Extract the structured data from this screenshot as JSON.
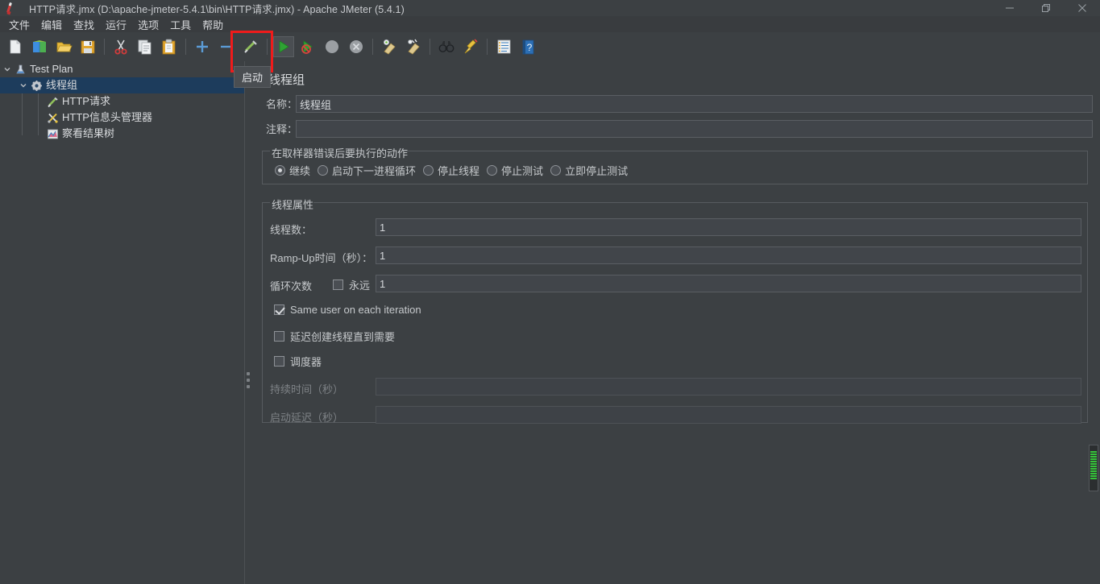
{
  "window": {
    "title": "HTTP请求.jmx (D:\\apache-jmeter-5.4.1\\bin\\HTTP请求.jmx) - Apache JMeter (5.4.1)",
    "app_icon": "jmeter-feather-icon",
    "controls": {
      "minimize": "minimize-icon",
      "maximize": "maximize-icon",
      "close": "close-icon"
    }
  },
  "menubar": {
    "items": [
      {
        "label": "文件"
      },
      {
        "label": "编辑"
      },
      {
        "label": "查找"
      },
      {
        "label": "运行"
      },
      {
        "label": "选项"
      },
      {
        "label": "工具"
      },
      {
        "label": "帮助"
      }
    ]
  },
  "toolbar": {
    "buttons": [
      {
        "name": "new-icon",
        "label": "新建"
      },
      {
        "name": "templates-icon",
        "label": "模板"
      },
      {
        "name": "open-icon",
        "label": "打开"
      },
      {
        "name": "save-icon",
        "label": "保存"
      },
      {
        "name": "cut-icon",
        "label": "剪切"
      },
      {
        "name": "copy-icon",
        "label": "复制"
      },
      {
        "name": "paste-icon",
        "label": "粘贴"
      },
      {
        "name": "expand-all-icon",
        "label": "展开全部"
      },
      {
        "name": "collapse-all-icon",
        "label": "折叠全部"
      },
      {
        "name": "toggle-icon",
        "label": "启用/禁用"
      },
      {
        "name": "start-icon",
        "label": "启动"
      },
      {
        "name": "start-no-pauses-icon",
        "label": "无间断启动"
      },
      {
        "name": "stop-icon",
        "label": "停止"
      },
      {
        "name": "shutdown-icon",
        "label": "关闭"
      },
      {
        "name": "clear-icon",
        "label": "清除"
      },
      {
        "name": "clear-all-icon",
        "label": "清除全部"
      },
      {
        "name": "search-icon",
        "label": "搜索"
      },
      {
        "name": "reset-search-icon",
        "label": "重置搜索"
      },
      {
        "name": "function-helper-icon",
        "label": "函数助手对话框"
      },
      {
        "name": "help-icon",
        "label": "帮助"
      }
    ],
    "active_button": "start-icon",
    "tooltip": "启动",
    "highlight_color": "#ef1b1b"
  },
  "tree": {
    "nodes": [
      {
        "label": "Test Plan",
        "icon": "test-plan-icon",
        "depth": 0,
        "expanded": true,
        "selected": false
      },
      {
        "label": "线程组",
        "icon": "thread-group-icon",
        "depth": 1,
        "expanded": true,
        "selected": true
      },
      {
        "label": "HTTP请求",
        "icon": "http-request-icon",
        "depth": 2,
        "expanded": null,
        "selected": false
      },
      {
        "label": "HTTP信息头管理器",
        "icon": "header-manager-icon",
        "depth": 2,
        "expanded": null,
        "selected": false
      },
      {
        "label": "察看结果树",
        "icon": "view-results-icon",
        "depth": 2,
        "expanded": null,
        "selected": false
      }
    ],
    "selection_color": "#1d3c5c"
  },
  "panel": {
    "title": "线程组",
    "fields": {
      "name_label": "名称：",
      "name_value": "线程组",
      "comment_label": "注释：",
      "comment_value": ""
    },
    "on_error": {
      "group_title": "在取样器错误后要执行的动作",
      "options": [
        {
          "label": "继续",
          "selected": true
        },
        {
          "label": "启动下一进程循环",
          "selected": false
        },
        {
          "label": "停止线程",
          "selected": false
        },
        {
          "label": "停止测试",
          "selected": false
        },
        {
          "label": "立即停止测试",
          "selected": false
        }
      ]
    },
    "thread_properties": {
      "group_title": "线程属性",
      "num_threads_label": "线程数：",
      "num_threads_value": "1",
      "ramp_up_label": "Ramp-Up时间（秒）：",
      "ramp_up_value": "1",
      "loop_count_label": "循环次数",
      "forever_label": "永远",
      "forever_checked": false,
      "loop_count_value": "1",
      "same_user_label": "Same user on each iteration",
      "same_user_checked": true,
      "delay_create_label": "延迟创建线程直到需要",
      "delay_create_checked": false,
      "scheduler_label": "调度器",
      "scheduler_checked": false,
      "duration_label": "持续时间（秒）",
      "duration_value": "",
      "duration_enabled": false,
      "startup_delay_label": "启动延迟（秒）",
      "startup_delay_value": "",
      "startup_delay_enabled": false
    }
  },
  "activity_meter": {
    "name": "thread-activity-meter",
    "color": "#36c23a",
    "segments": 12
  },
  "colors": {
    "background": "#3c4043",
    "titlebar": "#3c4043",
    "menubar": "#393c3f",
    "field_bg": "#41454a",
    "border": "#5a5e63",
    "text": "#c6c9cc"
  }
}
